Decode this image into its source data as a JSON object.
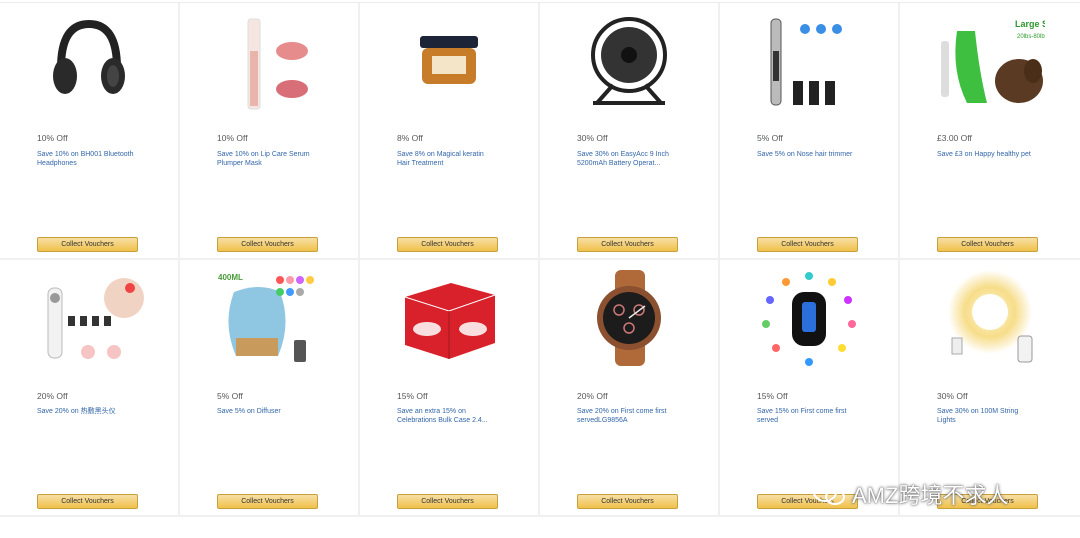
{
  "cards": [
    {
      "percent": "10% Off",
      "desc": "Save 10% on BH001 Bluetooth Headphones",
      "button": "Collect Vouchers",
      "icon": "headphones-icon"
    },
    {
      "percent": "10% Off",
      "desc": "Save 10% on Lip Care Serum Plumper Mask",
      "button": "Collect Vouchers",
      "icon": "lip-serum-icon"
    },
    {
      "percent": "8% Off",
      "desc": "Save 8% on Magical keratin Hair Treatment",
      "button": "Collect Vouchers",
      "icon": "hair-jar-icon"
    },
    {
      "percent": "30% Off",
      "desc": "Save 30% on EasyAcc 9 Inch 5200mAh Battery Operat...",
      "button": "Collect Vouchers",
      "icon": "fan-icon"
    },
    {
      "percent": "5% Off",
      "desc": "Save 5% on Nose hair trimmer",
      "button": "Collect Vouchers",
      "icon": "trimmer-icon"
    },
    {
      "percent": "£3.00 Off",
      "desc": "Save £3 on Happy healthy pet",
      "button": "Collect Vouchers",
      "icon": "dog-toothbrush-icon",
      "img_text": "Large Size\n20lbs-80lbs"
    },
    {
      "percent": "20% Off",
      "desc": "Save 20% on 热敷黑头仪",
      "button": "Collect Vouchers",
      "icon": "blackhead-remover-icon"
    },
    {
      "percent": "5% Off",
      "desc": "Save 5% on Diffuser",
      "button": "Collect Vouchers",
      "icon": "diffuser-icon",
      "img_text": "400ML"
    },
    {
      "percent": "15% Off",
      "desc": "Save an extra 15% on Celebrations Bulk Case 2.4...",
      "button": "Collect Vouchers",
      "icon": "celebrations-box-icon"
    },
    {
      "percent": "20% Off",
      "desc": "Save 20% on First come first servedLG9856A",
      "button": "Collect Vouchers",
      "icon": "watch-icon"
    },
    {
      "percent": "15% Off",
      "desc": "Save 15% on First come first served",
      "button": "Collect Vouchers",
      "icon": "fitness-tracker-icon"
    },
    {
      "percent": "30% Off",
      "desc": "Save 30% on 100M String Lights",
      "button": "Collect Vouchers",
      "icon": "string-lights-icon"
    }
  ],
  "watermark": "AMZ跨境不求人",
  "colors": {
    "button_top": "#f7dfa5",
    "button_bottom": "#f0c14b",
    "link": "#3366a8",
    "green": "#3fbf3f"
  }
}
